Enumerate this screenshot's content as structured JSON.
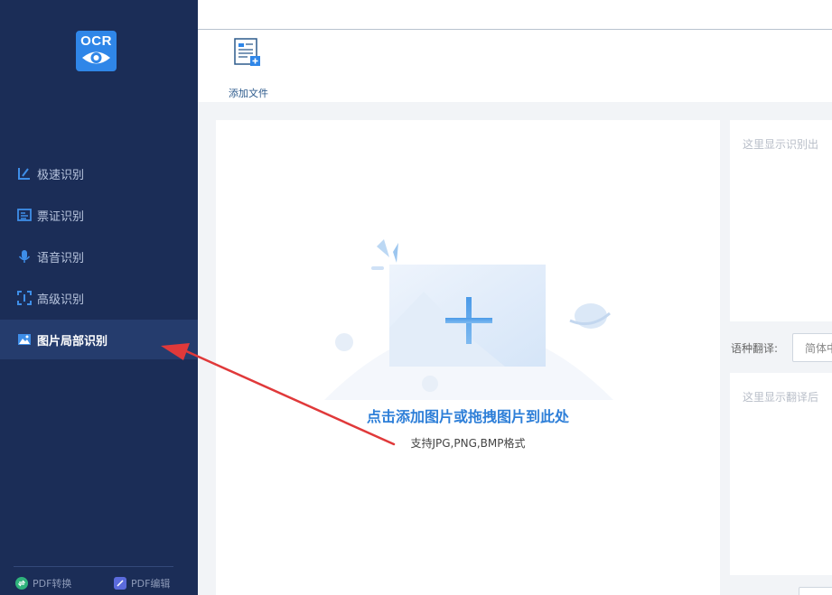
{
  "sidebar": {
    "logo_text": "OCR",
    "items": [
      {
        "label": "极速识别",
        "icon": "fast-recognition-icon"
      },
      {
        "label": "票证识别",
        "icon": "ticket-recognition-icon"
      },
      {
        "label": "语音识别",
        "icon": "microphone-icon"
      },
      {
        "label": "高级识别",
        "icon": "scan-frame-icon"
      },
      {
        "label": "图片局部识别",
        "icon": "image-region-icon",
        "active": true
      }
    ],
    "bottom_links": [
      {
        "label": "PDF转换",
        "icon": "pdf-convert-icon",
        "color": "#2fb37c"
      },
      {
        "label": "PDF编辑",
        "icon": "pdf-edit-icon",
        "color": "#5b6bdc"
      }
    ]
  },
  "toolbar": {
    "add_file_label": "添加文件"
  },
  "dropzone": {
    "main_text": "点击添加图片或拖拽图片到此处",
    "sub_text": "支持JPG,PNG,BMP格式"
  },
  "result": {
    "placeholder": "这里显示识别出"
  },
  "translate": {
    "label": "语种翻译:",
    "selected": "简体中",
    "placeholder": "这里显示翻译后"
  },
  "colors": {
    "sidebar_bg": "#1b2d57",
    "accent": "#2e7fd8",
    "annotation_arrow": "#e0393a"
  }
}
